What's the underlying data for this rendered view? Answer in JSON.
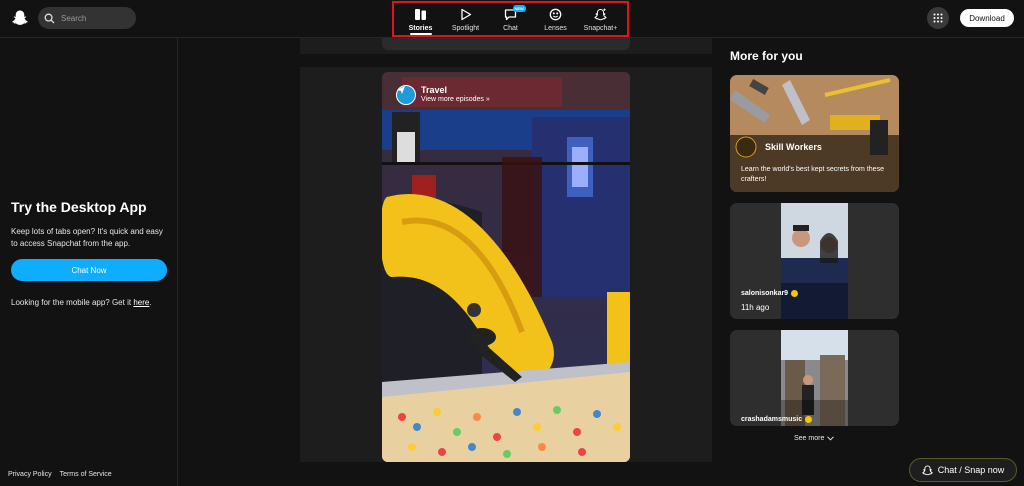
{
  "header": {
    "search_placeholder": "Search",
    "nav": [
      {
        "label": "Stories",
        "icon": "stories-icon",
        "active": true
      },
      {
        "label": "Spotlight",
        "icon": "spotlight-icon"
      },
      {
        "label": "Chat",
        "icon": "chat-icon",
        "badge": "NEW"
      },
      {
        "label": "Lenses",
        "icon": "lenses-icon"
      },
      {
        "label": "Snapchat+",
        "icon": "snapchat-plus-icon"
      }
    ],
    "download_label": "Download"
  },
  "left": {
    "promo_title": "Try the Desktop App",
    "promo_desc": "Keep lots of tabs open? It's quick and easy to access Snapchat from the app.",
    "chat_now_label": "Chat Now",
    "mobile_text": "Looking for the mobile app? Get it",
    "mobile_link": "here",
    "mobile_end": "."
  },
  "story": {
    "channel_name": "Travel",
    "channel_sub": "View more episodes »"
  },
  "right": {
    "title": "More for you",
    "cards": [
      {
        "title": "Skill Workers",
        "desc": "Learn the world's best kept secrets from these crafters!"
      },
      {
        "user": "salonisonkar9",
        "time": "11h ago"
      },
      {
        "user": "crashadamsmusic"
      }
    ],
    "see_more": "See more"
  },
  "footer": {
    "privacy": "Privacy Policy",
    "terms": "Terms of Service"
  },
  "snap_now_label": "Chat / Snap now",
  "colors": {
    "accent": "#0fadff",
    "highlight": "#e0121b",
    "background": "#121212"
  }
}
